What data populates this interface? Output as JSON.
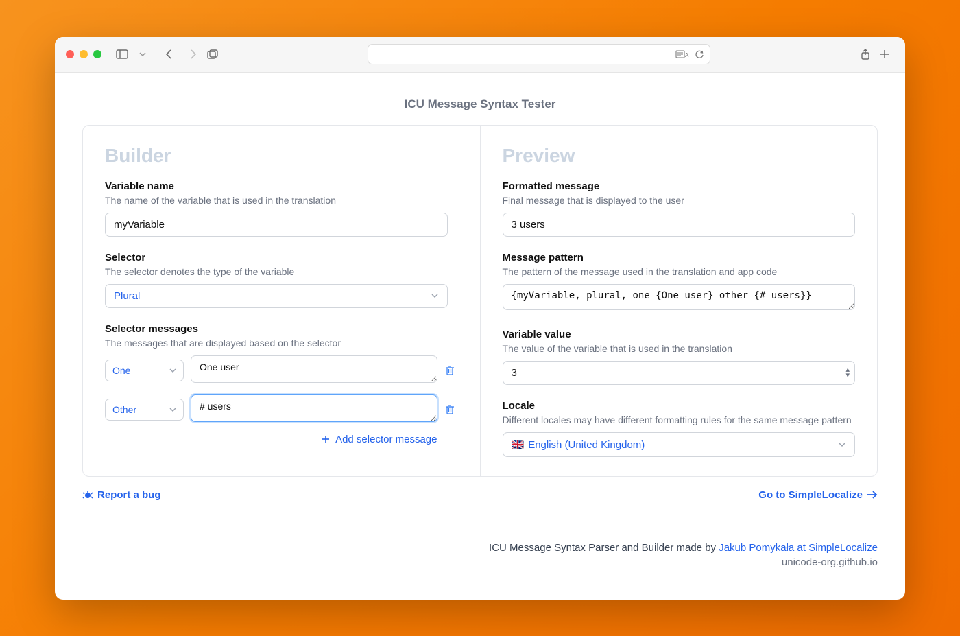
{
  "pageTitle": "ICU Message Syntax Tester",
  "builder": {
    "heading": "Builder",
    "varName": {
      "label": "Variable name",
      "desc": "The name of the variable that is used in the translation",
      "value": "myVariable"
    },
    "selector": {
      "label": "Selector",
      "desc": "The selector denotes the type of the variable",
      "value": "Plural"
    },
    "selectorMessages": {
      "label": "Selector messages",
      "desc": "The messages that are displayed based on the selector",
      "rows": [
        {
          "key": "One",
          "msg": "One user"
        },
        {
          "key": "Other",
          "msg": "# users"
        }
      ],
      "addLabel": "Add selector message"
    }
  },
  "preview": {
    "heading": "Preview",
    "formatted": {
      "label": "Formatted message",
      "desc": "Final message that is displayed to the user",
      "value": "3 users"
    },
    "pattern": {
      "label": "Message pattern",
      "desc": "The pattern of the message used in the translation and app code",
      "value": "{myVariable, plural, one {One user} other {# users}}"
    },
    "varValue": {
      "label": "Variable value",
      "desc": "The value of the variable that is used in the translation",
      "value": "3"
    },
    "locale": {
      "label": "Locale",
      "desc": "Different locales may have different formatting rules for the same message pattern",
      "flag": "🇬🇧",
      "value": "English (United Kingdom)"
    }
  },
  "footer": {
    "report": "Report a bug",
    "goto": "Go to SimpleLocalize",
    "creditPrefix": "ICU Message Syntax Parser and Builder made by ",
    "creditLink": "Jakub Pomykała at SimpleLocalize",
    "creditSub": "unicode-org.github.io"
  }
}
